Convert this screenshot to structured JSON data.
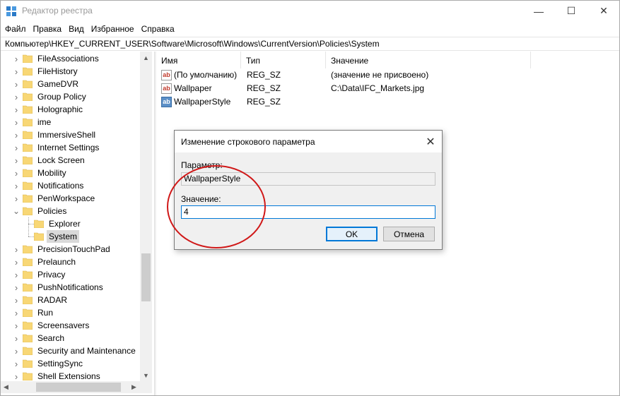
{
  "window": {
    "title": "Редактор реестра",
    "minimize_glyph": "—",
    "maximize_glyph": "☐",
    "close_glyph": "✕"
  },
  "menu": [
    "Файл",
    "Правка",
    "Вид",
    "Избранное",
    "Справка"
  ],
  "address": "Компьютер\\HKEY_CURRENT_USER\\Software\\Microsoft\\Windows\\CurrentVersion\\Policies\\System",
  "tree": [
    {
      "label": "FileAssociations",
      "expander": "collapsed",
      "level": 1
    },
    {
      "label": "FileHistory",
      "expander": "collapsed",
      "level": 1
    },
    {
      "label": "GameDVR",
      "expander": "collapsed",
      "level": 1
    },
    {
      "label": "Group Policy",
      "expander": "collapsed",
      "level": 1
    },
    {
      "label": "Holographic",
      "expander": "collapsed",
      "level": 1
    },
    {
      "label": "ime",
      "expander": "collapsed",
      "level": 1
    },
    {
      "label": "ImmersiveShell",
      "expander": "collapsed",
      "level": 1
    },
    {
      "label": "Internet Settings",
      "expander": "collapsed",
      "level": 1
    },
    {
      "label": "Lock Screen",
      "expander": "collapsed",
      "level": 1
    },
    {
      "label": "Mobility",
      "expander": "collapsed",
      "level": 1
    },
    {
      "label": "Notifications",
      "expander": "collapsed",
      "level": 1
    },
    {
      "label": "PenWorkspace",
      "expander": "collapsed",
      "level": 1
    },
    {
      "label": "Policies",
      "expander": "expanded",
      "level": 1
    },
    {
      "label": "Explorer",
      "expander": "none",
      "level": 2
    },
    {
      "label": "System",
      "expander": "none",
      "level": 2,
      "selected": true
    },
    {
      "label": "PrecisionTouchPad",
      "expander": "collapsed",
      "level": 1
    },
    {
      "label": "Prelaunch",
      "expander": "collapsed",
      "level": 1
    },
    {
      "label": "Privacy",
      "expander": "collapsed",
      "level": 1
    },
    {
      "label": "PushNotifications",
      "expander": "collapsed",
      "level": 1
    },
    {
      "label": "RADAR",
      "expander": "collapsed",
      "level": 1
    },
    {
      "label": "Run",
      "expander": "collapsed",
      "level": 1
    },
    {
      "label": "Screensavers",
      "expander": "collapsed",
      "level": 1
    },
    {
      "label": "Search",
      "expander": "collapsed",
      "level": 1
    },
    {
      "label": "Security and Maintenance",
      "expander": "collapsed",
      "level": 1
    },
    {
      "label": "SettingSync",
      "expander": "collapsed",
      "level": 1
    },
    {
      "label": "Shell Extensions",
      "expander": "collapsed",
      "level": 1
    }
  ],
  "list": {
    "columns": [
      "Имя",
      "Тип",
      "Значение"
    ],
    "rows": [
      {
        "icon": "string-value-icon",
        "name": "(По умолчанию)",
        "type": "REG_SZ",
        "value": "(значение не присвоено)",
        "ab": "ab"
      },
      {
        "icon": "string-value-icon",
        "name": "Wallpaper",
        "type": "REG_SZ",
        "value": "C:\\Data\\IFC_Markets.jpg",
        "ab": "ab"
      },
      {
        "icon": "string-value-icon-selected",
        "name": "WallpaperStyle",
        "type": "REG_SZ",
        "value": "",
        "ab": "ab"
      }
    ]
  },
  "dialog": {
    "title": "Изменение строкового параметра",
    "param_label": "Параметр:",
    "param_value": "WallpaperStyle",
    "value_label": "Значение:",
    "value": "4",
    "ok_label": "OK",
    "cancel_label": "Отмена",
    "close_glyph": "✕"
  },
  "colors": {
    "accent": "#0078d7",
    "folder": "#f8d775",
    "annotation": "#d01818"
  }
}
